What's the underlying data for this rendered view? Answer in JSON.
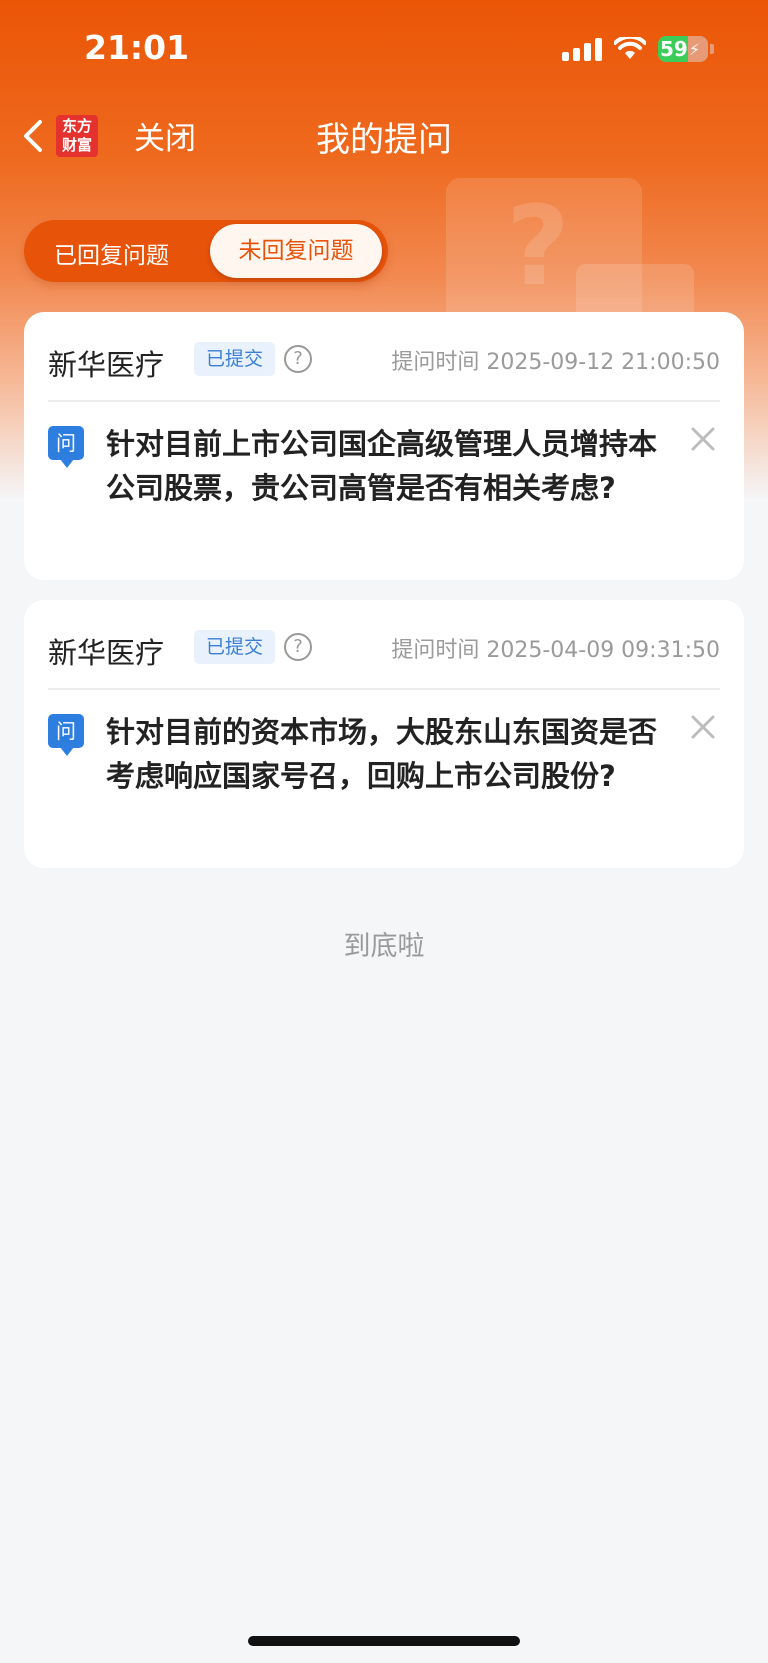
{
  "status_bar": {
    "time": "21:01",
    "battery": "59"
  },
  "nav": {
    "logo_text": "东方财富",
    "logo_line1": "东方",
    "logo_line2": "财富",
    "close_label": "关闭",
    "title": "我的提问"
  },
  "tabs": {
    "replied": "已回复问题",
    "unreplied": "未回复问题",
    "active": "未回复问题"
  },
  "questions": [
    {
      "company": "新华医疗",
      "status": "已提交",
      "help": "?",
      "time": "提问时间 2025-09-12 21:00:50",
      "q_label": "问",
      "text": "针对目前上市公司国企高级管理人员增持本公司股票，贵公司高管是否有相关考虑?"
    },
    {
      "company": "新华医疗",
      "status": "已提交",
      "help": "?",
      "time": "提问时间 2025-04-09 09:31:50",
      "q_label": "问",
      "text": "针对目前的资本市场，大股东山东国资是否考虑响应国家号召，回购上市公司股份?"
    }
  ],
  "footer": {
    "end_text": "到底啦"
  },
  "colors": {
    "brand_orange": "#eb5506",
    "badge_blue": "#3b7fd6",
    "question_icon_blue": "#2e7ee0"
  }
}
